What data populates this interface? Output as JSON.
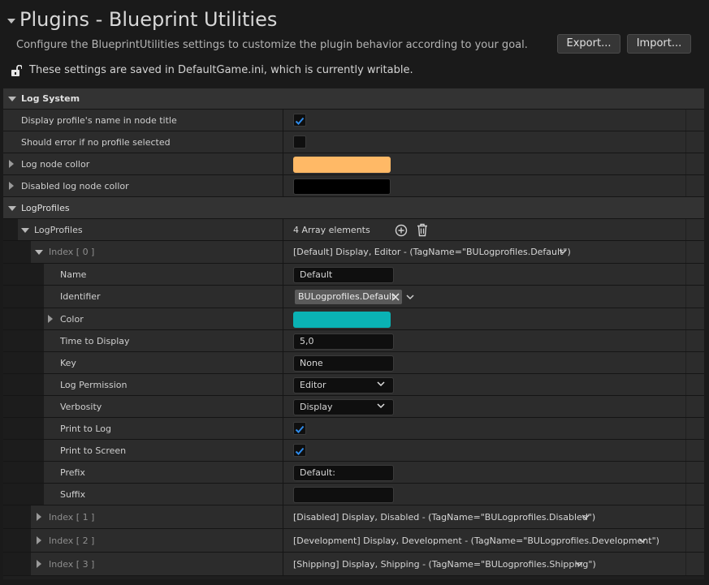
{
  "header": {
    "title": "Plugins - Blueprint Utilities",
    "subtitle": "Configure the BlueprintUtilities settings to customize the plugin behavior according to your goal.",
    "export_label": "Export...",
    "import_label": "Import...",
    "saved_notice": "These settings are saved in DefaultGame.ini, which is currently writable."
  },
  "log_system": {
    "category_label": "Log System",
    "display_profile_name_label": "Display profile's name in node title",
    "display_profile_name_checked": true,
    "error_no_profile_label": "Should error if no profile selected",
    "error_no_profile_checked": false,
    "log_node_color_label": "Log node collor",
    "log_node_color": "#FFB966",
    "disabled_log_node_color_label": "Disabled log node collor",
    "disabled_log_node_color": "#000000"
  },
  "log_profiles": {
    "category_label": "LogProfiles",
    "array_label": "LogProfiles",
    "array_count": "4 Array elements",
    "index0": {
      "label": "Index [ 0 ]",
      "summary": "[Default] Display, Editor - (TagName=\"BULogprofiles.Default\")",
      "name_label": "Name",
      "name_value": "Default",
      "identifier_label": "Identifier",
      "identifier_tag": "BULogprofiles.Default",
      "color_label": "Color",
      "color": "#0AB2B4",
      "time_label": "Time to Display",
      "time_value": "5,0",
      "key_label": "Key",
      "key_value": "None",
      "permission_label": "Log Permission",
      "permission_value": "Editor",
      "verbosity_label": "Verbosity",
      "verbosity_value": "Display",
      "print_log_label": "Print to Log",
      "print_log_checked": true,
      "print_screen_label": "Print to Screen",
      "print_screen_checked": true,
      "prefix_label": "Prefix",
      "prefix_value": "Default:",
      "suffix_label": "Suffix",
      "suffix_value": ""
    },
    "index1": {
      "label": "Index [ 1 ]",
      "summary": "[Disabled] Display, Disabled - (TagName=\"BULogprofiles.Disabled\")"
    },
    "index2": {
      "label": "Index [ 2 ]",
      "summary": "[Development] Display, Development - (TagName=\"BULogprofiles.Development\")"
    },
    "index3": {
      "label": "Index [ 3 ]",
      "summary": "[Shipping] Display, Shipping - (TagName=\"BULogprofiles.Shipping\")"
    }
  },
  "colors": {
    "accent": "#1E78D7",
    "check": "#2E8BEA"
  }
}
